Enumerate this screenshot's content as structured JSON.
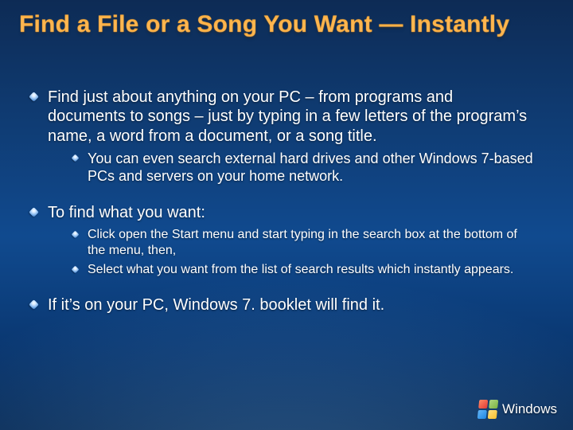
{
  "title": "Find a File or a Song You Want — Instantly",
  "bullets": {
    "b1": "Find just about anything on your PC – from programs and documents to songs – just by typing in a few letters of the program’s name, a word from a document, or a song title.",
    "b1_sub1": "You can even search external hard drives and other Windows 7-based PCs and servers on your home network.",
    "b2": "To find what you want:",
    "b2_sub1": "Click open the Start menu and start typing in the search box at the bottom of the menu, then,",
    "b2_sub2": "Select what you want from the list of search results which instantly appears.",
    "b3": "If it’s on your PC, Windows 7. booklet will find it."
  },
  "brand": "Windows"
}
